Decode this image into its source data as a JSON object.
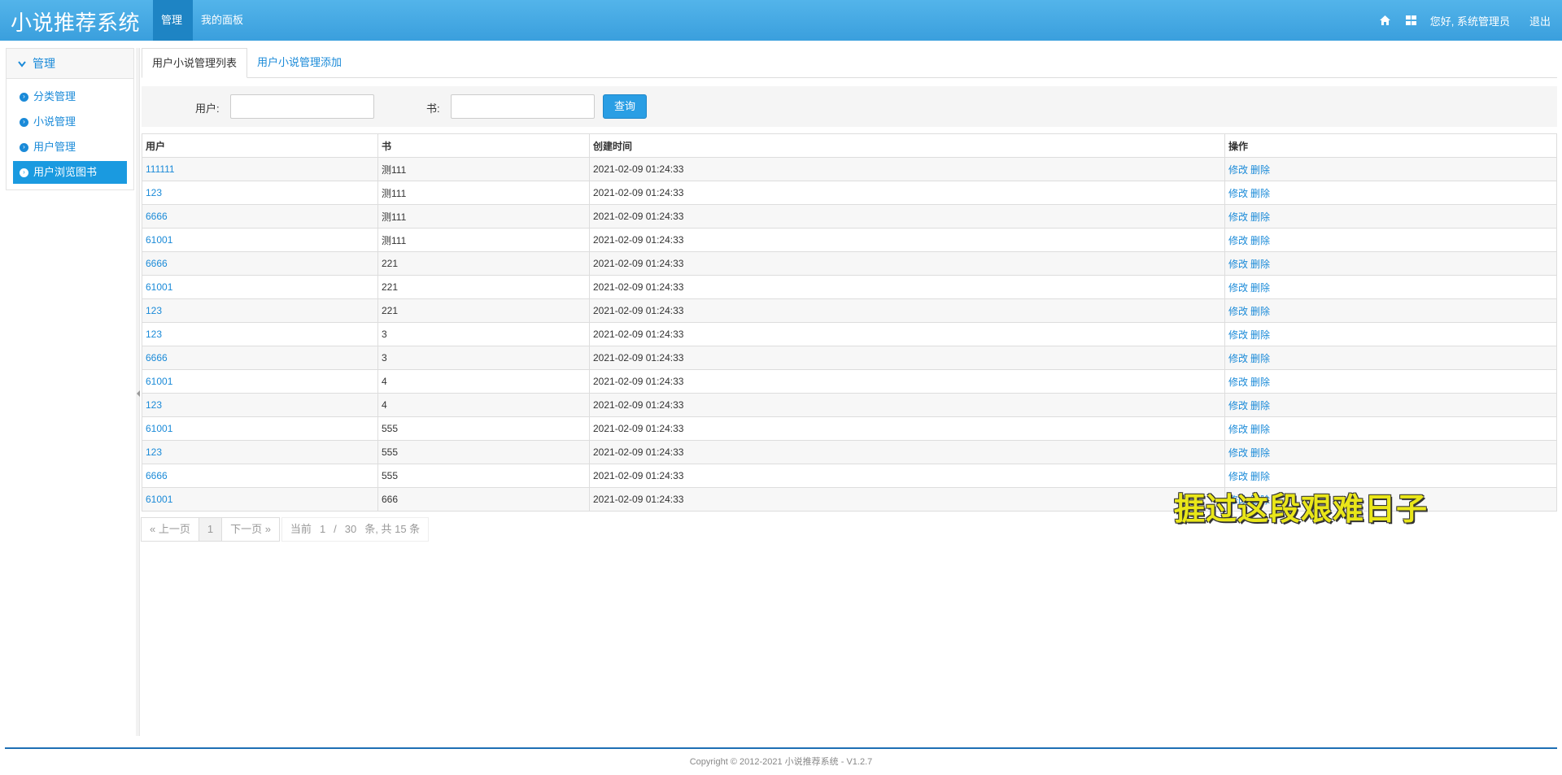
{
  "app": {
    "brand": "小说推荐系统"
  },
  "topnav": {
    "manage": "管理",
    "panel": "我的面板",
    "greeting": "您好, 系统管理员",
    "logout": "退出"
  },
  "sidebar": {
    "header": "管理",
    "items": [
      {
        "label": "分类管理",
        "active": false
      },
      {
        "label": "小说管理",
        "active": false
      },
      {
        "label": "用户管理",
        "active": false
      },
      {
        "label": "用户浏览图书",
        "active": true
      }
    ]
  },
  "tabs": {
    "list": "用户小说管理列表",
    "add": "用户小说管理添加"
  },
  "search": {
    "user_label": "用户:",
    "book_label": "书:",
    "user_value": "",
    "book_value": "",
    "button": "查询"
  },
  "table": {
    "headers": [
      "用户",
      "书",
      "创建时间",
      "操作"
    ],
    "edit_label": "修改",
    "delete_label": "删除",
    "rows": [
      {
        "user": "111111",
        "book": "测111",
        "created": "2021-02-09 01:24:33"
      },
      {
        "user": "123",
        "book": "测111",
        "created": "2021-02-09 01:24:33"
      },
      {
        "user": "6666",
        "book": "测111",
        "created": "2021-02-09 01:24:33"
      },
      {
        "user": "61001",
        "book": "测111",
        "created": "2021-02-09 01:24:33"
      },
      {
        "user": "6666",
        "book": "221",
        "created": "2021-02-09 01:24:33"
      },
      {
        "user": "61001",
        "book": "221",
        "created": "2021-02-09 01:24:33"
      },
      {
        "user": "123",
        "book": "221",
        "created": "2021-02-09 01:24:33"
      },
      {
        "user": "123",
        "book": "3",
        "created": "2021-02-09 01:24:33"
      },
      {
        "user": "6666",
        "book": "3",
        "created": "2021-02-09 01:24:33"
      },
      {
        "user": "61001",
        "book": "4",
        "created": "2021-02-09 01:24:33"
      },
      {
        "user": "123",
        "book": "4",
        "created": "2021-02-09 01:24:33"
      },
      {
        "user": "61001",
        "book": "555",
        "created": "2021-02-09 01:24:33"
      },
      {
        "user": "123",
        "book": "555",
        "created": "2021-02-09 01:24:33"
      },
      {
        "user": "6666",
        "book": "555",
        "created": "2021-02-09 01:24:33"
      },
      {
        "user": "61001",
        "book": "666",
        "created": "2021-02-09 01:24:33"
      }
    ]
  },
  "pager": {
    "prev": "« 上一页",
    "current": "1",
    "next": "下一页 »",
    "info_prefix": "当前",
    "info_page": "1",
    "info_sep": "/",
    "info_total_pages": "30",
    "info_suffix": "条, 共 15 条"
  },
  "overlay_caption": "捱过这段艰难日子",
  "footer": {
    "copyright": "Copyright © 2012-2021 小说推荐系统 - V1.2.7"
  },
  "icons": {
    "home": "home-icon",
    "dashboard": "dashboard-icon"
  },
  "colors": {
    "topbar": "#3a9fdd",
    "accent": "#1a8ad8",
    "active_item": "#1a9ae0",
    "caption": "#e9e619"
  }
}
